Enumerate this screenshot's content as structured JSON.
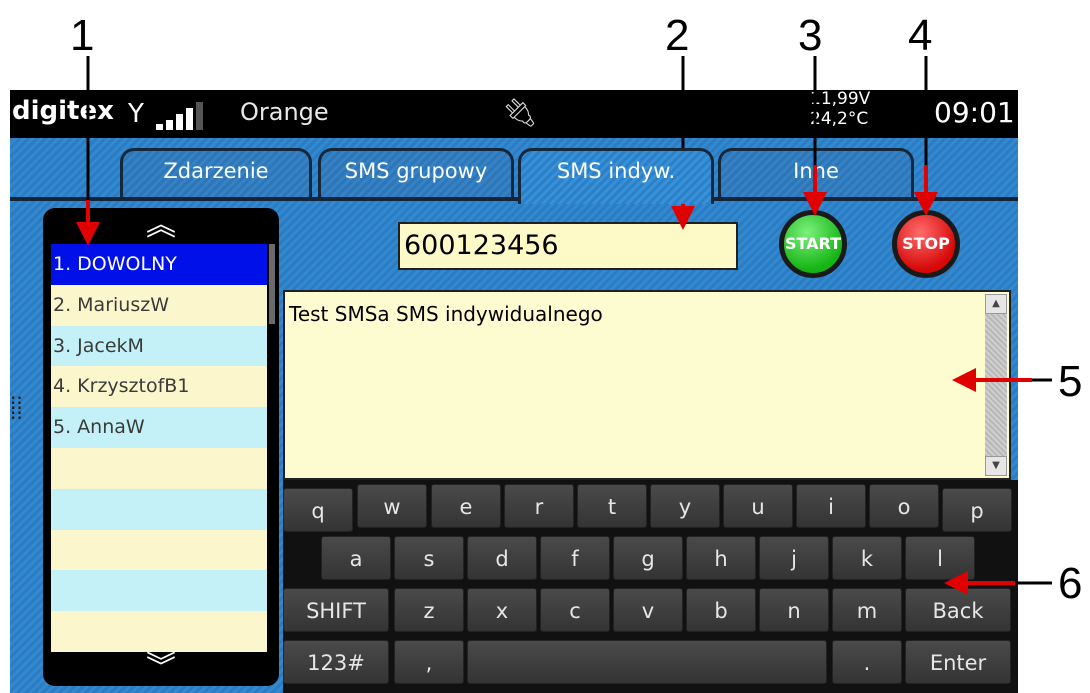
{
  "callouts": [
    "1",
    "2",
    "3",
    "4",
    "5",
    "6"
  ],
  "statusbar": {
    "brand": "digitex",
    "operator": "Orange",
    "voltage": "11,99V",
    "temperature": "24,2°C",
    "time": "09:01"
  },
  "tabs": [
    "Zdarzenie",
    "SMS grupowy",
    "SMS indyw.",
    "Inne"
  ],
  "active_tab": "SMS indyw.",
  "contacts": [
    "1. DOWOLNY",
    "2. MariuszW",
    "3. JacekM",
    "4. KrzysztofB1",
    "5. AnnaW"
  ],
  "selected_contact": "1. DOWOLNY",
  "phone_number": "600123456",
  "buttons": {
    "start": "START",
    "stop": "STOP"
  },
  "message": "Test SMSa SMS indywidualnego",
  "keyboard": {
    "row1": [
      "q",
      "w",
      "e",
      "r",
      "t",
      "y",
      "u",
      "i",
      "o",
      "p"
    ],
    "row2": [
      "a",
      "s",
      "d",
      "f",
      "g",
      "h",
      "j",
      "k",
      "l"
    ],
    "row3": [
      "SHIFT",
      "z",
      "x",
      "c",
      "v",
      "b",
      "n",
      "m",
      "Back"
    ],
    "row4": [
      "123#",
      ",",
      "",
      ".",
      "Enter"
    ]
  },
  "colors": {
    "panel_blue": "#3388cf",
    "selected_row": "#0010e8",
    "row_yellow": "#fcf6cd",
    "row_cyan": "#c4f0f7",
    "start_green": "#15b515",
    "stop_red": "#d60808",
    "arrow_red": "#e00000"
  },
  "icons": [
    "antenna-icon",
    "signal-bars-icon",
    "plug-icon",
    "chevron-up-icon",
    "chevron-down-icon"
  ]
}
